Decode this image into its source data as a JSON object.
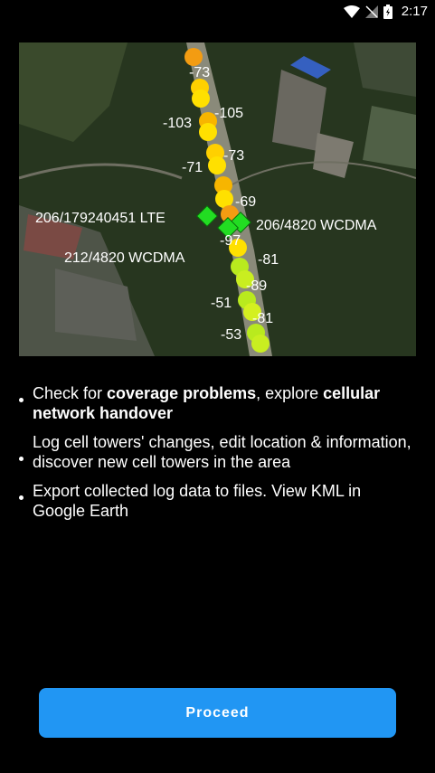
{
  "status_bar": {
    "time": "2:17",
    "icons": [
      "wifi-icon",
      "no-signal-icon",
      "battery-charging-icon"
    ]
  },
  "map": {
    "signal_labels": [
      "-73",
      "-103",
      "-105",
      "-73",
      "-71",
      "-69",
      "-97",
      "-81",
      "-89",
      "-51",
      "-81",
      "-53"
    ],
    "tower_labels": [
      "206/179240451 LTE",
      "206/4820 WCDMA",
      "212/4820 WCDMA"
    ],
    "colors": {
      "orange": "#f39c12",
      "yellow": "#ffe000",
      "yellow_green": "#b9ea1e",
      "tower": "#22dd22"
    }
  },
  "features": [
    {
      "parts": [
        "Check for ",
        "coverage problems",
        ", explore ",
        "cellular network handover"
      ]
    },
    {
      "text": "Log cell towers' changes, edit location & information, discover new cell towers in the area"
    },
    {
      "text": "Export collected log data to files. View KML in Google Earth"
    }
  ],
  "proceed_label": "Proceed",
  "accent_color": "#2196f3"
}
